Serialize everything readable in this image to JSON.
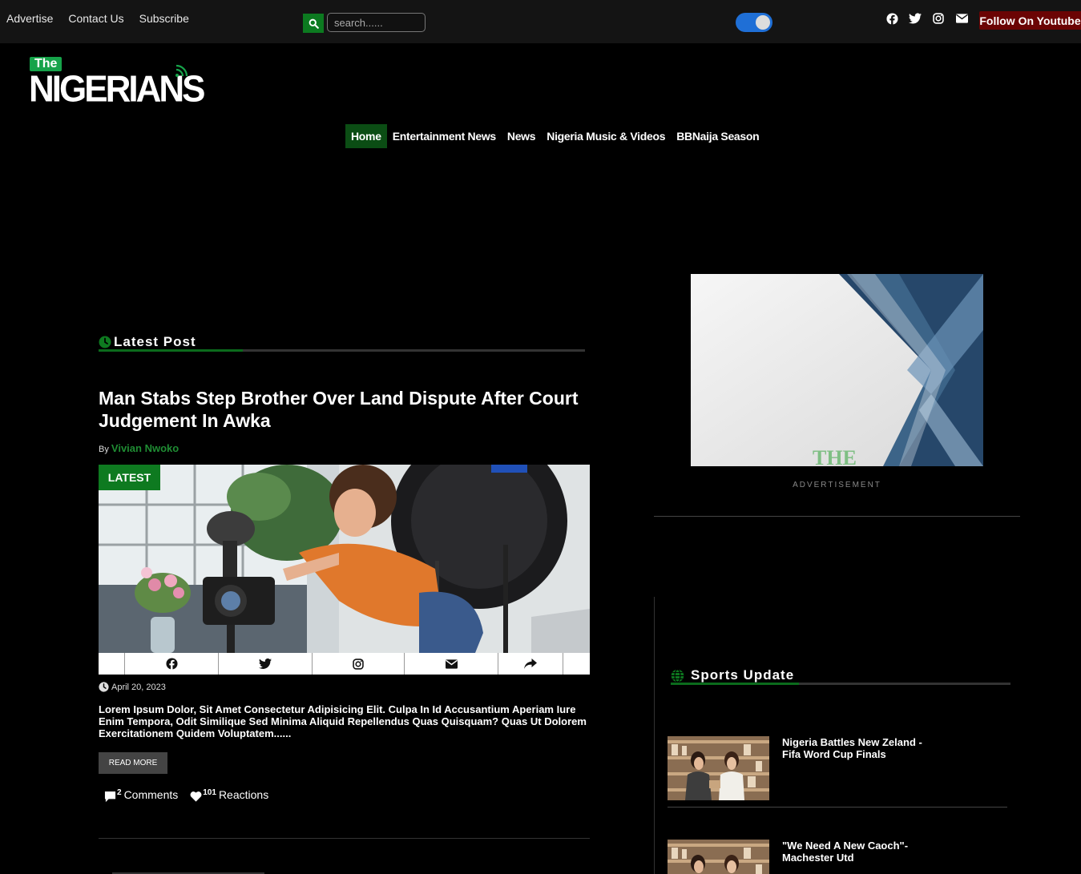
{
  "topbar": {
    "links": [
      "Advertise",
      "Contact Us",
      "Subscribe"
    ],
    "search_placeholder": "search......",
    "follow_label": "Follow On Youtube"
  },
  "logo": {
    "the": "The",
    "name": "NIGERIANS"
  },
  "nav": [
    "Home",
    "Entertainment News",
    "News",
    "Nigeria Music & Videos",
    "BBNaija Season"
  ],
  "latest": {
    "heading": "Latest Post",
    "post": {
      "title": "Man Stabs Step Brother Over Land Dispute After Court Judgement In Awka",
      "by": "By",
      "author": "Vivian Nwoko",
      "badge": "LATEST",
      "date": "April 20, 2023",
      "excerpt": "Lorem Ipsum Dolor, Sit Amet Consectetur Adipisicing Elit. Culpa In Id Accusantium Aperiam Iure Enim Tempora, Odit Similique Sed Minima Aliquid Repellendus Quas Quisquam? Quas Ut Dolorem Exercitationem Quidem Voluptatem......",
      "read_more": "READ MORE",
      "comments_count": "2",
      "comments_label": "Comments",
      "reactions_count": "101",
      "reactions_label": "Reactions"
    }
  },
  "sidebar": {
    "ad_text": "THE",
    "ad_label": "ADVERTISEMENT",
    "sports_heading": "Sports Update",
    "sports": [
      {
        "title": "Nigeria Battles New Zeland - Fifa Word Cup Finals"
      },
      {
        "title": "\"We Need A New Caoch\"- Machester Utd"
      }
    ]
  },
  "colors": {
    "accent_green": "#0e7a20",
    "follow_red": "#6b0404",
    "toggle_blue": "#1f6fd6"
  }
}
